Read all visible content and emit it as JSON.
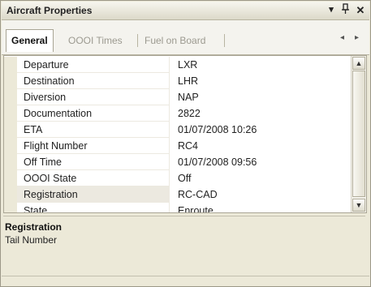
{
  "window": {
    "title": "Aircraft Properties",
    "dropdown_icon": "▾",
    "pin_icon": "ᵖ",
    "close_icon": "✕"
  },
  "tabs": [
    {
      "label": "General",
      "active": true
    },
    {
      "label": "OOOI Times",
      "active": false
    },
    {
      "label": "Fuel on Board",
      "active": false
    }
  ],
  "tab_nav": {
    "prev": "◂",
    "next": "▸"
  },
  "properties": [
    {
      "name": "Departure",
      "value": "LXR"
    },
    {
      "name": "Destination",
      "value": "LHR"
    },
    {
      "name": "Diversion",
      "value": "NAP"
    },
    {
      "name": "Documentation",
      "value": "2822"
    },
    {
      "name": "ETA",
      "value": "01/07/2008 10:26"
    },
    {
      "name": "Flight Number",
      "value": "RC4"
    },
    {
      "name": "Off Time",
      "value": "01/07/2008 09:56"
    },
    {
      "name": "OOOI State",
      "value": "Off"
    },
    {
      "name": "Registration",
      "value": "RC-CAD"
    },
    {
      "name": "State",
      "value": "Enroute"
    }
  ],
  "selected_property": "Registration",
  "description": {
    "title": "Registration",
    "text": "Tail Number"
  },
  "scrollbar": {
    "up": "▲",
    "down": "▼"
  }
}
